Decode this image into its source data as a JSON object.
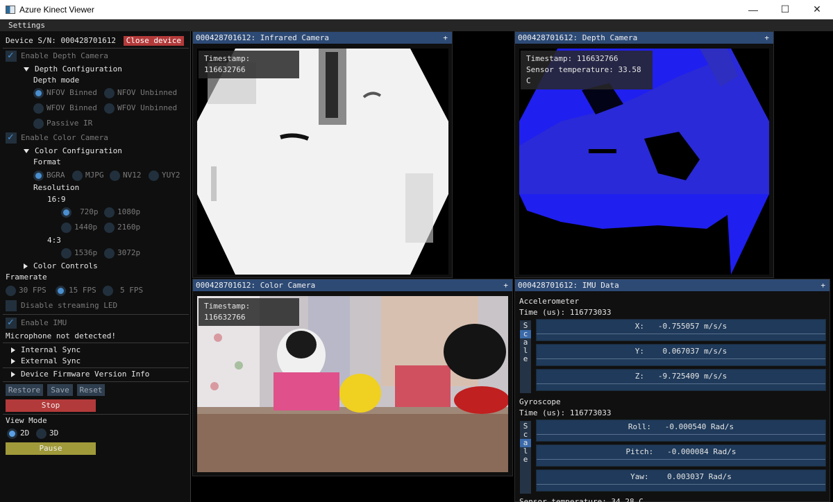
{
  "window": {
    "title": "Azure Kinect Viewer",
    "min": "—",
    "max": "☐",
    "close": "✕"
  },
  "menu": {
    "settings": "Settings"
  },
  "device": {
    "sn_label": "Device S/N: 000428701612",
    "close_label": "Close device"
  },
  "depth": {
    "enable_label": "Enable Depth Camera",
    "config_label": "Depth Configuration",
    "mode_label": "Depth mode",
    "modes": [
      "NFOV Binned",
      "NFOV Unbinned",
      "WFOV Binned",
      "WFOV Unbinned",
      "Passive IR"
    ]
  },
  "color": {
    "enable_label": "Enable Color Camera",
    "config_label": "Color Configuration",
    "format_label": "Format",
    "formats": [
      "BGRA",
      "MJPG",
      "NV12",
      "YUY2"
    ],
    "resolution_label": "Resolution",
    "aspect_169": "16:9",
    "res_169": [
      "720p",
      "1080p",
      "1440p",
      "2160p"
    ],
    "aspect_43": "4:3",
    "res_43": [
      "1536p",
      "3072p"
    ],
    "controls_label": "Color Controls"
  },
  "framerate": {
    "label": "Framerate",
    "options": [
      "30 FPS",
      "15 FPS",
      "5 FPS"
    ],
    "led_label": "Disable streaming LED"
  },
  "imu_toggle": {
    "label": "Enable IMU"
  },
  "mic_status": "Microphone not detected!",
  "sections": {
    "internal_sync": "Internal Sync",
    "external_sync": "External Sync",
    "firmware": "Device Firmware Version Info"
  },
  "buttons": {
    "restore": "Restore",
    "save": "Save",
    "reset": "Reset",
    "stop": "Stop",
    "pause": "Pause"
  },
  "view_mode": {
    "label": "View Mode",
    "options": [
      "2D",
      "3D"
    ]
  },
  "ir_window": {
    "title": "000428701612: Infrared Camera",
    "plus": "+",
    "timestamp": "Timestamp: 116632766"
  },
  "depth_window": {
    "title": "000428701612: Depth Camera",
    "plus": "+",
    "timestamp": "Timestamp: 116632766",
    "temperature": "Sensor temperature: 33.58 C"
  },
  "color_window": {
    "title": "000428701612: Color Camera",
    "plus": "+",
    "timestamp": "Timestamp: 116632766"
  },
  "imu_window": {
    "title": "000428701612: IMU Data",
    "plus": "+",
    "accel_label": "Accelerometer",
    "accel_time": "Time (us): 116773033",
    "accel_x": "X:   -0.755057 m/s/s",
    "accel_y": "Y:    0.067037 m/s/s",
    "accel_z": "Z:   -9.725409 m/s/s",
    "gyro_label": "Gyroscope",
    "gyro_time": "Time (us): 116773033",
    "gyro_roll": "Roll:   -0.000540 Rad/s",
    "gyro_pitch": "Pitch:   -0.000084 Rad/s",
    "gyro_yaw": "Yaw:    0.003037 Rad/s",
    "scale_letters": [
      "S",
      "c",
      "a",
      "l",
      "e"
    ],
    "sensor_temp": "Sensor temperature: 34.28 C"
  }
}
